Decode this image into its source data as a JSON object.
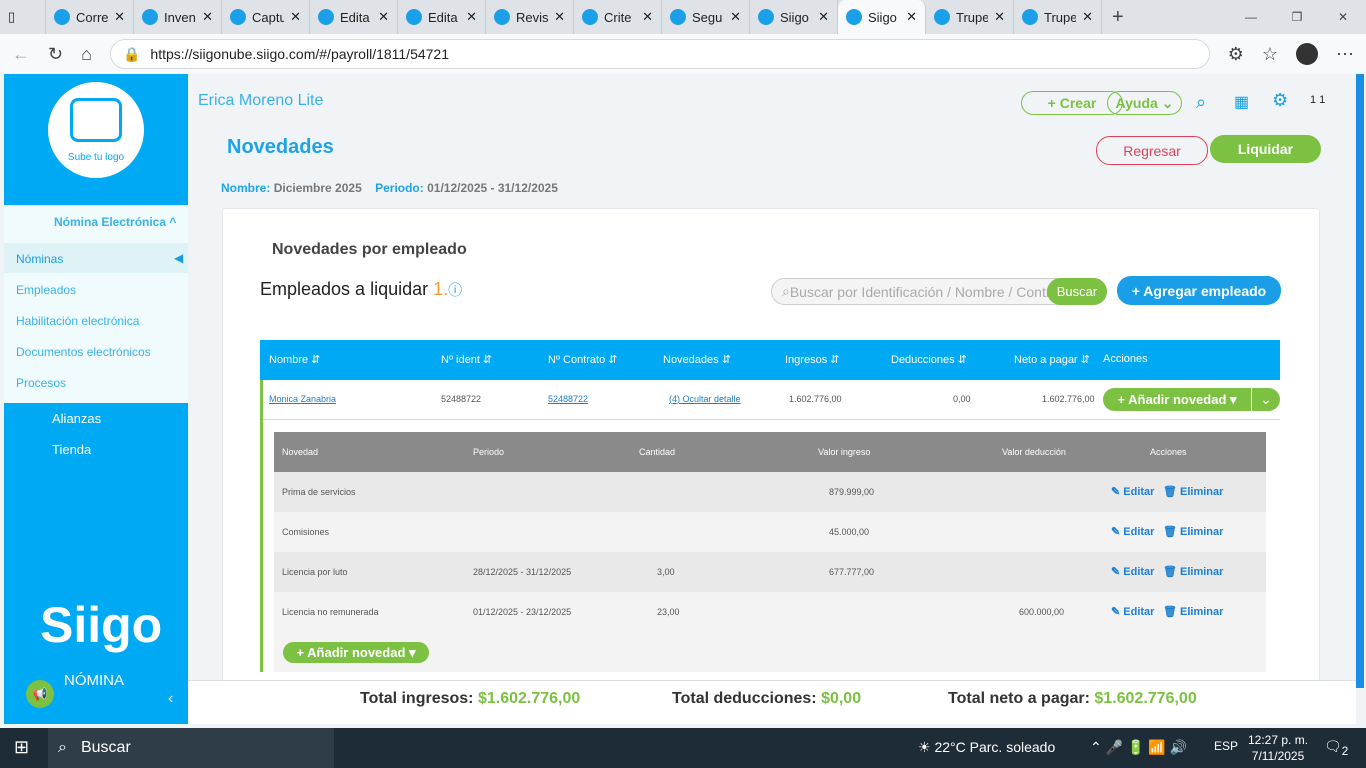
{
  "browser": {
    "tabs": [
      {
        "label": ""
      },
      {
        "label": "Corre"
      },
      {
        "label": "Inven"
      },
      {
        "label": "Captu"
      },
      {
        "label": "Edita"
      },
      {
        "label": "Edita"
      },
      {
        "label": "Revis"
      },
      {
        "label": "Crite"
      },
      {
        "label": "Segu"
      },
      {
        "label": "Siigo"
      },
      {
        "label": "Siigo",
        "active": true
      },
      {
        "label": "Trupe"
      },
      {
        "label": "Trupe"
      }
    ],
    "url": "https://siigonube.siigo.com/#/payroll/1811/54721"
  },
  "sidebar": {
    "logo_text": "Sube tu logo",
    "section": "Nómina Electrónica ^",
    "items": [
      {
        "label": "Nóminas",
        "active": true
      },
      {
        "label": "Empleados"
      },
      {
        "label": "Habilitación electrónica"
      },
      {
        "label": "Documentos electrónicos"
      },
      {
        "label": "Procesos"
      }
    ],
    "alianzas": "Alianzas",
    "tienda": "Tienda",
    "brand": "Siigo",
    "brand_sub": "NÓMINA"
  },
  "header": {
    "company": "Erica Moreno Lite",
    "crear": "+ Crear",
    "ayuda": "Ayuda ⌄",
    "user": "1 1"
  },
  "page": {
    "title": "Novedades",
    "regresar": "Regresar",
    "liquidar": "Liquidar",
    "nombre_label": "Nombre:",
    "nombre": "Diciembre 2025",
    "periodo_label": "Periodo:",
    "periodo": "01/12/2025 - 31/12/2025"
  },
  "card": {
    "title": "Novedades por empleado",
    "empleados_label": "Empleados a liquidar",
    "empleados_count": "1.",
    "search_placeholder": "Buscar por Identificación / Nombre / Contrato",
    "buscar": "Buscar",
    "agregar": "+ Agregar empleado"
  },
  "table": {
    "headers": [
      "Nombre ⇵",
      "Nº ident ⇵",
      "Nº Contrato ⇵",
      "Novedades ⇵",
      "Ingresos ⇵",
      "Deducciones ⇵",
      "Neto a pagar ⇵",
      "Acciones"
    ],
    "row": {
      "nombre": "Monica Zanabria",
      "ident": "52488722",
      "contrato": "52488722",
      "novedades": "(4) Ocultar detalle",
      "ingresos": "1.602.776,00",
      "deducciones": "0,00",
      "neto": "1.602.776,00",
      "accion": "+ Añadir novedad ▾"
    }
  },
  "detail": {
    "headers": [
      "Novedad",
      "Periodo",
      "Cantidad",
      "Valor ingreso",
      "Valor deducción",
      "Acciones"
    ],
    "rows": [
      {
        "novedad": "Prima de servicios",
        "periodo": "",
        "cantidad": "",
        "ingreso": "879.999,00",
        "deduccion": ""
      },
      {
        "novedad": "Comisiones",
        "periodo": "",
        "cantidad": "",
        "ingreso": "45.000,00",
        "deduccion": ""
      },
      {
        "novedad": "Licencia por luto",
        "periodo": "28/12/2025 - 31/12/2025",
        "cantidad": "3,00",
        "ingreso": "677.777,00",
        "deduccion": ""
      },
      {
        "novedad": "Licencia no remunerada",
        "periodo": "01/12/2025 - 23/12/2025",
        "cantidad": "23,00",
        "ingreso": "",
        "deduccion": "600.000,00"
      }
    ],
    "editar": "✎ Editar",
    "eliminar": "🗑 Eliminar",
    "add": "+ Añadir novedad ▾"
  },
  "footer": {
    "ingresos_label": "Total ingresos:",
    "ingresos": "$1.602.776,00",
    "deducciones_label": "Total deducciones:",
    "deducciones": "$0,00",
    "neto_label": "Total neto a pagar:",
    "neto": "$1.602.776,00"
  },
  "taskbar": {
    "search": "Buscar",
    "weather": "22°C  Parc. soleado",
    "lang": "ESP",
    "time": "12:27 p. m.",
    "date": "7/11/2025",
    "notif": "2"
  },
  "colors": {
    "primary": "#00a9f4",
    "green": "#7cc142",
    "red": "#e0405a"
  }
}
